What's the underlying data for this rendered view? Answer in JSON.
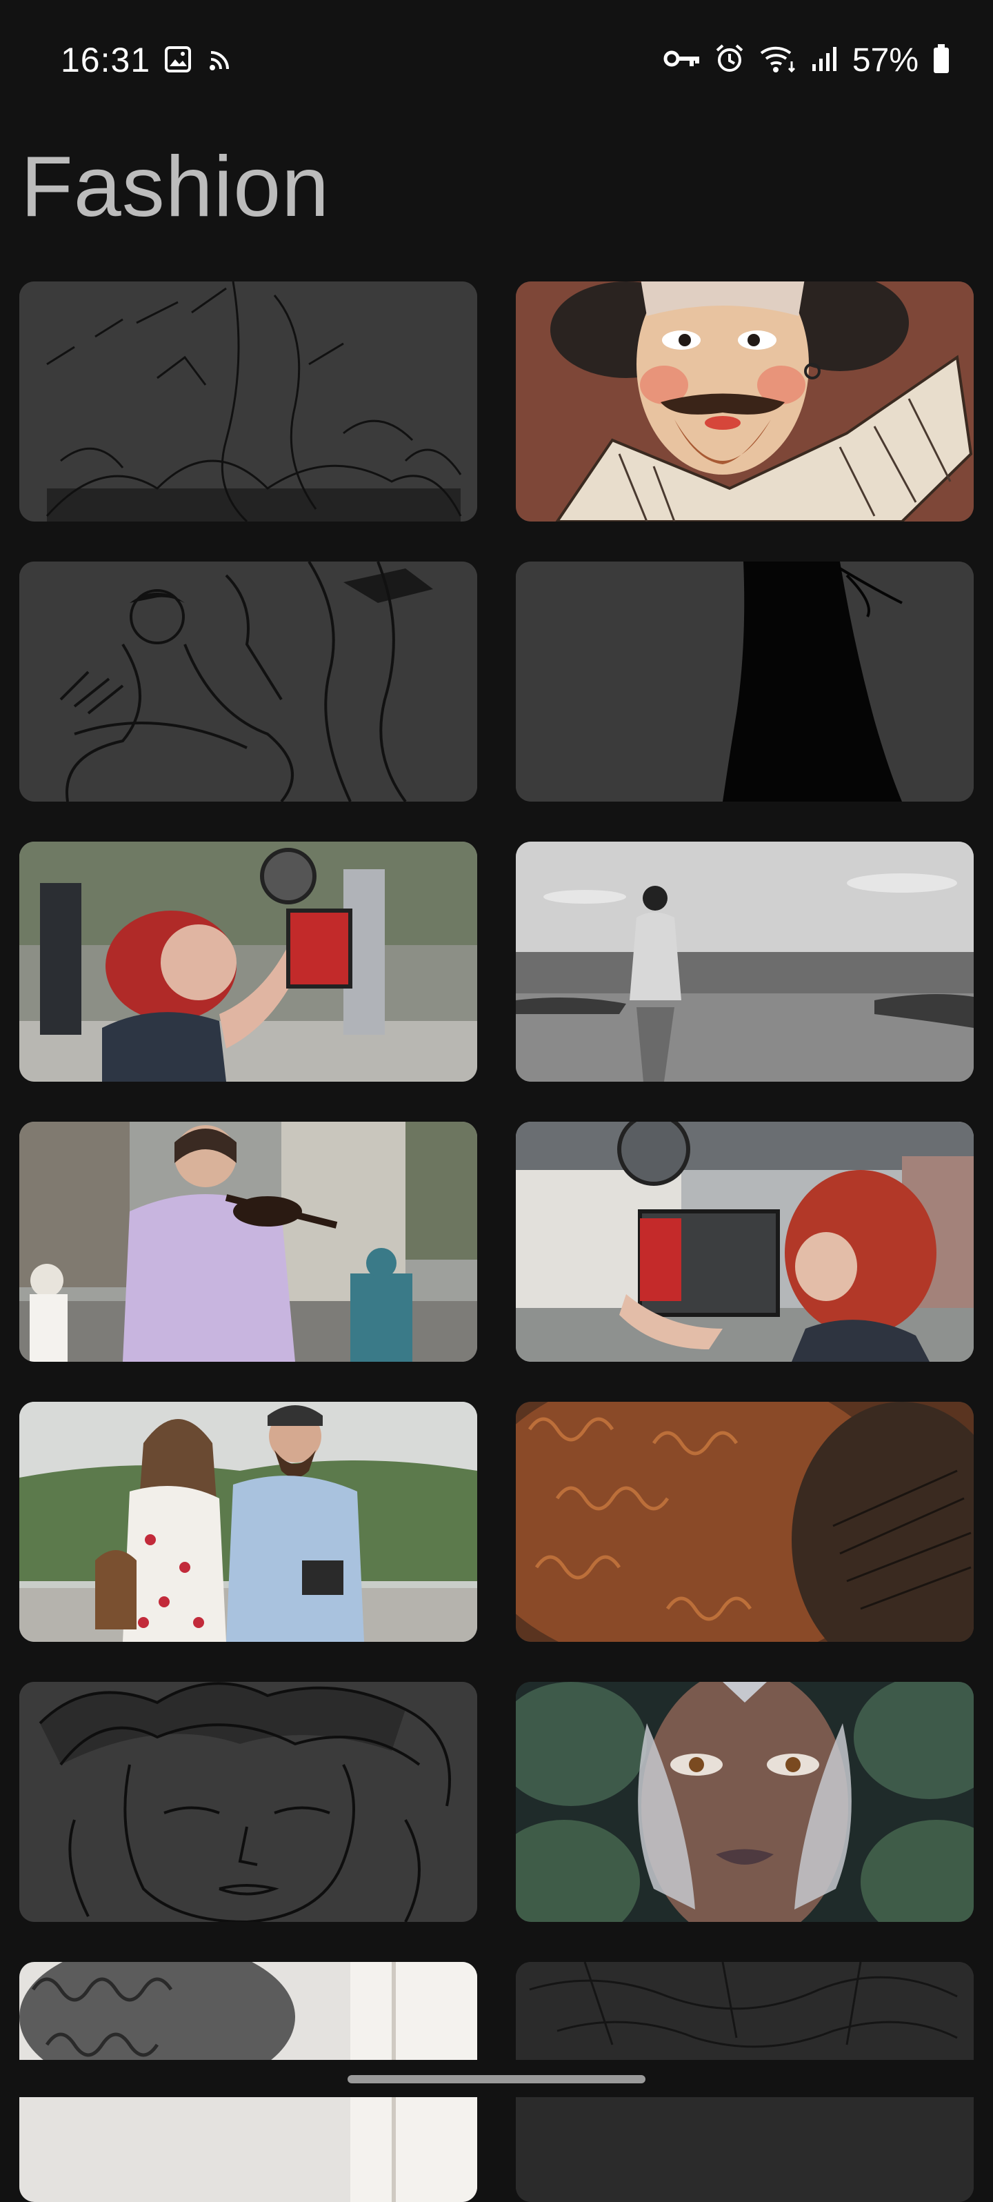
{
  "status_bar": {
    "time": "16:31",
    "battery": "57%",
    "left_icons": [
      "image-icon",
      "cast-icon"
    ],
    "right_icons": [
      "vpn-key-icon",
      "alarm-icon",
      "wifi-icon",
      "signal-icon",
      "battery-icon"
    ]
  },
  "page": {
    "title": "Fashion"
  },
  "gallery": {
    "tiles": [
      {
        "id": "tile-1",
        "subject": "line-art-garden-illustration"
      },
      {
        "id": "tile-2",
        "subject": "shakespeare-portrait-illustration"
      },
      {
        "id": "tile-3",
        "subject": "line-art-couple-illustration"
      },
      {
        "id": "tile-4",
        "subject": "silhouette-dress-illustration"
      },
      {
        "id": "tile-5",
        "subject": "red-haired-woman-with-camera-photo"
      },
      {
        "id": "tile-6",
        "subject": "woman-at-sea-bw-photo"
      },
      {
        "id": "tile-7",
        "subject": "woman-playing-violin-photo"
      },
      {
        "id": "tile-8",
        "subject": "woman-with-vintage-camera-photo"
      },
      {
        "id": "tile-9",
        "subject": "couple-with-camera-photo"
      },
      {
        "id": "tile-10",
        "subject": "curly-red-hair-closeup-photo"
      },
      {
        "id": "tile-11",
        "subject": "line-art-woman-face-illustration"
      },
      {
        "id": "tile-12",
        "subject": "ornate-face-mask-portrait"
      },
      {
        "id": "tile-13",
        "subject": "curly-hair-sketch-photo"
      },
      {
        "id": "tile-14",
        "subject": "dark-engraving-illustration"
      }
    ]
  },
  "colors": {
    "background": "#121212",
    "tile_placeholder": "#3a3a3a",
    "title": "#bcbcbc"
  }
}
